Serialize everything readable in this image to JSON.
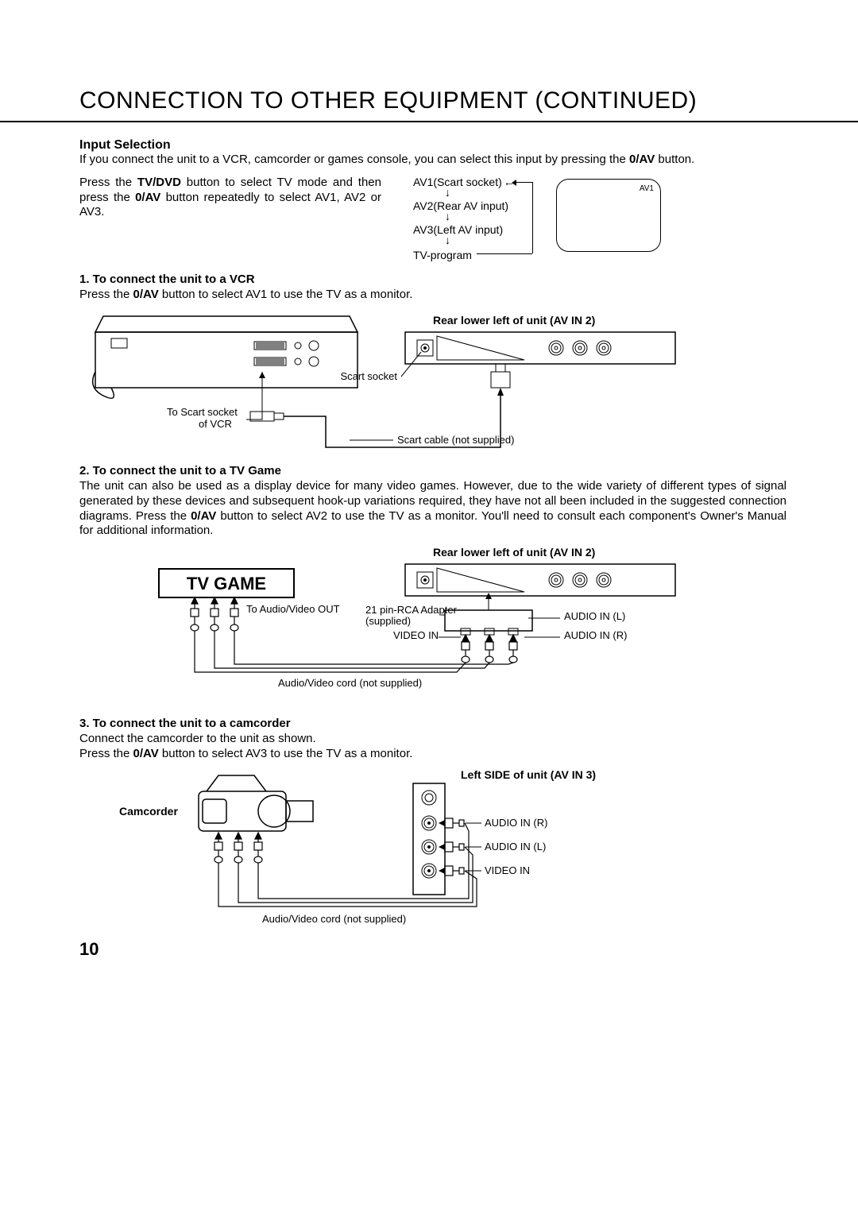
{
  "title": "CONNECTION TO OTHER EQUIPMENT   (CONTINUED)",
  "input_selection": {
    "heading": "Input Selection",
    "intro_pre": "If you connect the unit to a VCR, camcorder or games console, you can select this input by pressing the ",
    "intro_bold": "0/AV",
    "intro_post": " button.",
    "press_pre": "Press the ",
    "tv_dvd": "TV/DVD",
    "press_mid": " button to select TV mode and then press the ",
    "zero_av": "0/AV",
    "press_post": " button repeatedly to select AV1, AV2 or AV3."
  },
  "cycle": {
    "av1": "AV1(Scart socket)",
    "av2": "AV2(Rear AV input)",
    "av3": "AV3(Left AV input)",
    "tv": "TV-program"
  },
  "tv_screen_label": "AV1",
  "sections": {
    "vcr": {
      "title": "1. To connect the unit to a VCR",
      "body_pre": "Press the ",
      "body_bold": "0/AV",
      "body_post": " button to select AV1 to use the TV as a monitor.",
      "panel_label": "Rear lower left of unit (AV IN 2)",
      "scart_socket": "Scart socket",
      "to_scart_socket": "To Scart socket",
      "of_vcr": "of VCR",
      "scart_cable": "Scart cable (not supplied)"
    },
    "game": {
      "title": "2. To connect the unit to a TV Game",
      "body_pre": "The unit can also be used as a display device for many video games. However, due to the wide variety of different types of signal generated by these devices and subsequent hook-up variations required, they have not all been included in the suggested connection diagrams. Press the ",
      "body_bold": "0/AV",
      "body_post": " button to select AV2 to use the TV as a monitor. You'll need to consult each component's Owner's Manual for additional information.",
      "panel_label": "Rear lower left of unit (AV IN 2)",
      "tv_game": "TV GAME",
      "to_av_out": "To Audio/Video OUT",
      "adapter1": "21 pin-RCA Adapter",
      "adapter2": "(supplied)",
      "video_in": "VIDEO IN",
      "audio_l": "AUDIO IN (L)",
      "audio_r": "AUDIO IN (R)",
      "av_cord": "Audio/Video cord (not supplied)"
    },
    "cam": {
      "title": "3. To connect the unit to a camcorder",
      "line1": "Connect the camcorder to the unit as shown.",
      "body_pre": "Press the ",
      "body_bold": "0/AV",
      "body_post": " button to select AV3 to use the TV as a monitor.",
      "panel_label": "Left SIDE of unit (AV IN 3)",
      "camcorder": "Camcorder",
      "audio_r": "AUDIO IN (R)",
      "audio_l": "AUDIO IN (L)",
      "video_in": "VIDEO IN",
      "av_cord": "Audio/Video cord (not supplied)"
    }
  },
  "page_number": "10"
}
